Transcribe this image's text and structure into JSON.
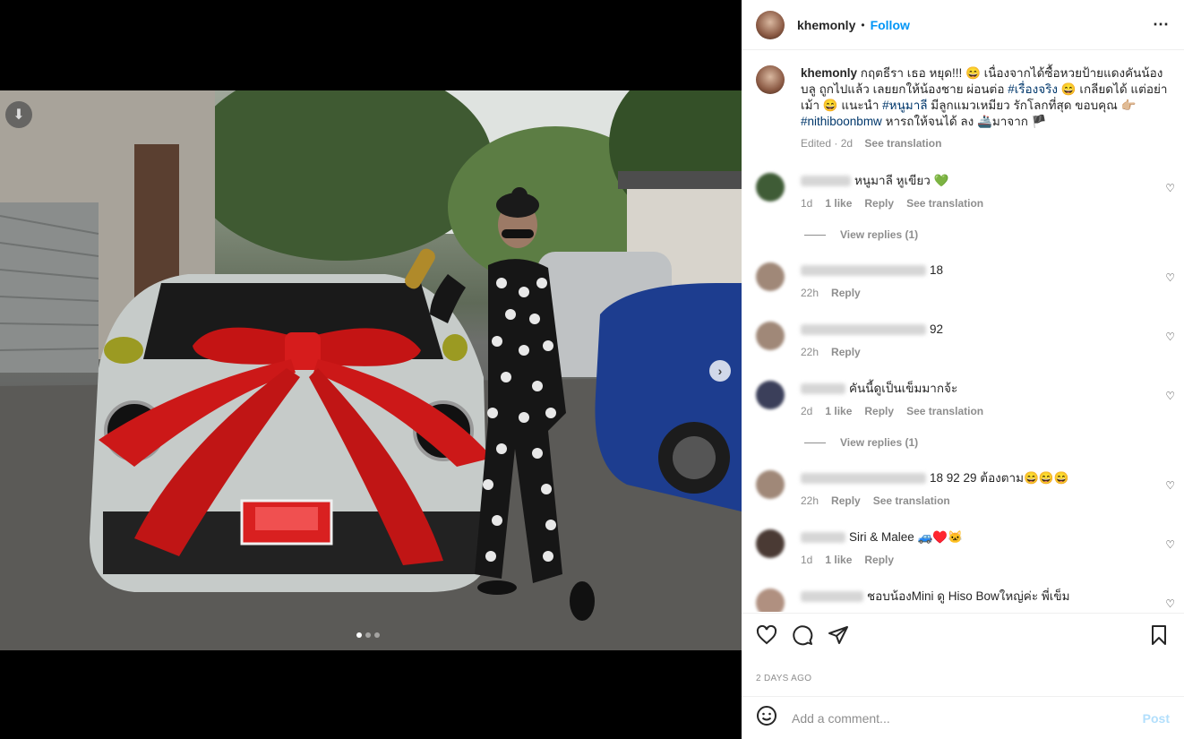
{
  "post": {
    "username": "khemonly",
    "follow_label": "Follow",
    "separator": "•",
    "more_icon": "⋯",
    "caption_user": "khemonly",
    "caption_parts": {
      "p1": "กฤตธีรา เธอ หยุด!!! 😄 เนื่องจากได้ซื้อหวยป้ายแดงคันน้องบลู ถูกไปแล้ว เลยยกให้น้องชาย ผ่อนต่อ ",
      "tag1": "#เรื่องจริง",
      "p2": " 😄 เกลียดได้ แต่อย่าเม้า 😄 แนะนำ ",
      "tag2": "#หนูมาลี",
      "p3": " มีลูกแมวเหมียว รักโลกที่สุด ขอบคุณ 👉🏼",
      "tag3": "#nithiboonbmw",
      "p4": " หารถให้จนได้ ลง 🚢มาจาก 🏴"
    },
    "caption_meta": "Edited · 2d",
    "see_translation": "See translation",
    "date": "2 DAYS AGO",
    "image_dots": 3,
    "image_active_dot": 1
  },
  "comments": [
    {
      "text": "หนูมาลี หูเขียว 💚",
      "age": "1d",
      "likes": "1 like",
      "reply": "Reply",
      "translate": "See translation",
      "replies": "View replies (1)",
      "avatar": "#3f5c36"
    },
    {
      "text": "18",
      "age": "22h",
      "likes": "",
      "reply": "Reply",
      "translate": "",
      "replies": "",
      "avatar": "#a08878"
    },
    {
      "text": "92",
      "age": "22h",
      "likes": "",
      "reply": "Reply",
      "translate": "",
      "replies": "",
      "avatar": "#a08878"
    },
    {
      "text": "คันนี้ดูเป็นเข็มมากจ้ะ",
      "age": "2d",
      "likes": "1 like",
      "reply": "Reply",
      "translate": "See translation",
      "replies": "View replies (1)",
      "avatar": "#3b3f5a"
    },
    {
      "text": "18 92 29 ต้องตาม😄😄😄",
      "age": "22h",
      "likes": "",
      "reply": "Reply",
      "translate": "See translation",
      "replies": "",
      "avatar": "#a08878"
    },
    {
      "text": "Siri & Malee 🚙♥️🐱",
      "age": "1d",
      "likes": "1 like",
      "reply": "Reply",
      "translate": "",
      "replies": "",
      "avatar": "#4a3a34"
    },
    {
      "text": "ชอบน้องMini ดู Hiso Bowใหญ่ค่ะ พี่เข็ม",
      "age": "",
      "likes": "",
      "reply": "",
      "translate": "",
      "replies": "",
      "avatar": "#b09080"
    }
  ],
  "add_comment": {
    "placeholder": "Add a comment...",
    "post_label": "Post"
  }
}
